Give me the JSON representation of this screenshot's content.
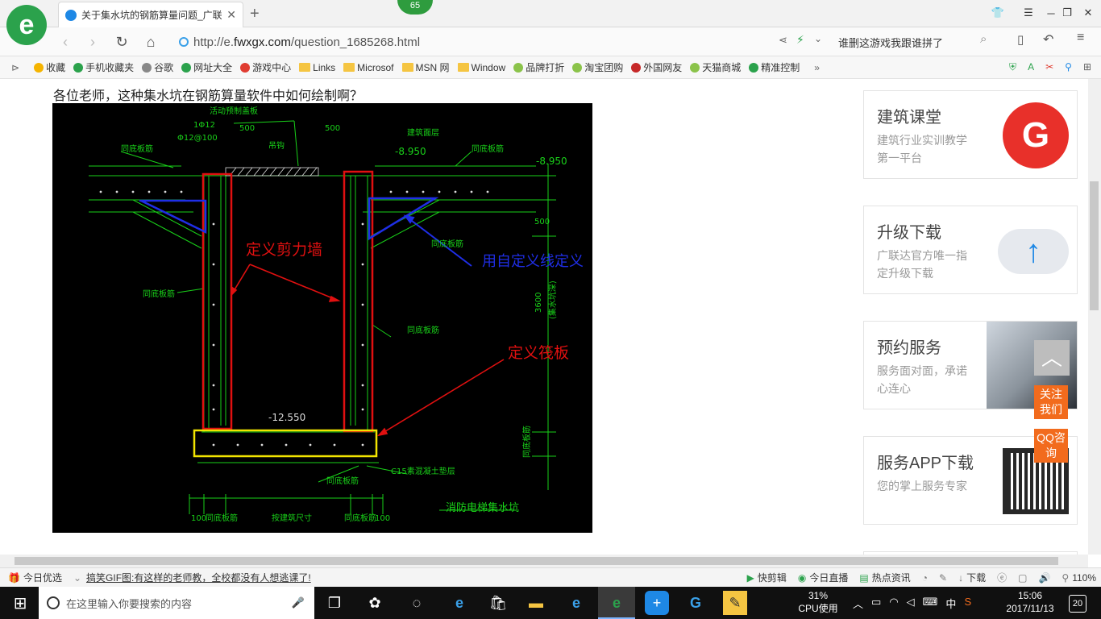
{
  "browser": {
    "tab_title": "关于集水坑的钢筋算量问题_广联",
    "badge": "65",
    "url_scheme": "http://e.",
    "url_host": "fwxgx.com",
    "url_path": "/question_1685268.html",
    "search_text": "谁删这游戏我跟谁拼了"
  },
  "bookmarks": [
    {
      "label": "收藏",
      "icon": "star-icon",
      "color": "#f5b400"
    },
    {
      "label": "手机收藏夹",
      "icon": "phone-icon",
      "color": "#2ba24c"
    },
    {
      "label": "谷歌",
      "icon": "page-icon",
      "color": "#888888"
    },
    {
      "label": "网址大全",
      "icon": "globe-icon",
      "color": "#2ba24c"
    },
    {
      "label": "游戏中心",
      "icon": "game-icon",
      "color": "#e03c31"
    },
    {
      "label": "Links",
      "icon": "folder-icon",
      "color": "#f5c542"
    },
    {
      "label": "Microsof",
      "icon": "folder-icon",
      "color": "#f5c542"
    },
    {
      "label": "MSN 网",
      "icon": "folder-icon",
      "color": "#f5c542"
    },
    {
      "label": "Window",
      "icon": "folder-icon",
      "color": "#f5c542"
    },
    {
      "label": "品牌打折",
      "icon": "leaf-icon",
      "color": "#8bc34a"
    },
    {
      "label": "淘宝团购",
      "icon": "leaf-icon",
      "color": "#8bc34a"
    },
    {
      "label": "外国网友",
      "icon": "flag-icon",
      "color": "#c62828"
    },
    {
      "label": "天猫商城",
      "icon": "leaf-icon",
      "color": "#8bc34a"
    },
    {
      "label": "精准控制",
      "icon": "chat-icon",
      "color": "#2ba24c"
    }
  ],
  "page": {
    "question": "各位老师，这种集水坑在钢筋算量软件中如何绘制啊？"
  },
  "cad": {
    "labels": {
      "top_plate": "活动预制盖板",
      "top_layer": "建筑面层",
      "elev1": "-8.950",
      "elev2": "-8.950",
      "elev3": "-12.550",
      "dim_500a": "500",
      "dim_500b": "500",
      "dim_500c": "500",
      "dim_100a": "100",
      "dim_100b": "100",
      "dim_3600": "3600",
      "pit_depth": "(集水坑深)",
      "rebar1": "同底板筋",
      "rebar2": "同底板筋",
      "rebar3": "同底板筋",
      "rebar4": "同底板筋",
      "rebar5": "同底板筋",
      "rebar6": "同底板筋",
      "rebar_left": "同底板筋",
      "rebar_right": "同底板筋",
      "rebar_bottom_r": "同底板筋",
      "bar_spec1": "1Φ12",
      "bar_spec2": "Φ12@100",
      "hook": "吊钩",
      "cushion": "C15素混凝土垫层",
      "pit_name": "消防电梯集水坑",
      "size_label": "按建筑尺寸",
      "ann_shear_wall": "定义剪力墙",
      "ann_custom_line": "用自定义线定义",
      "ann_raft": "定义筏板"
    },
    "colors": {
      "line": "#19d119",
      "shear_wall": "#e01010",
      "custom_line": "#1f2ee6",
      "raft": "#f2e400"
    }
  },
  "sidebar": {
    "cards": [
      {
        "title": "建筑课堂",
        "sub": "建筑行业实训教学第一平台",
        "icon": "gld-logo-icon"
      },
      {
        "title": "升级下载",
        "sub": "广联达官方唯一指定升级下载",
        "icon": "cloud-upload-icon"
      },
      {
        "title": "预约服务",
        "sub": "服务面对面，承诺心连心",
        "icon": "handshake-icon"
      },
      {
        "title": "服务APP下载",
        "sub": "您的掌上服务专家",
        "icon": "qr-code-icon"
      }
    ],
    "float_follow": "关注我们",
    "float_qq": "QQ咨询"
  },
  "statusbar": {
    "left1": "今日优选",
    "headline": "搞笑GIF图:有这样的老师教，全校都没有人想逃课了!",
    "r1": "快剪辑",
    "r2": "今日直播",
    "r3": "热点资讯",
    "r4": "下载",
    "zoom": "110%"
  },
  "taskbar": {
    "search_placeholder": "在这里输入你要搜索的内容",
    "cpu_value": "31%",
    "cpu_label": "CPU使用",
    "ime": "中",
    "time": "15:06",
    "date": "2017/11/13",
    "notif_count": "20"
  }
}
